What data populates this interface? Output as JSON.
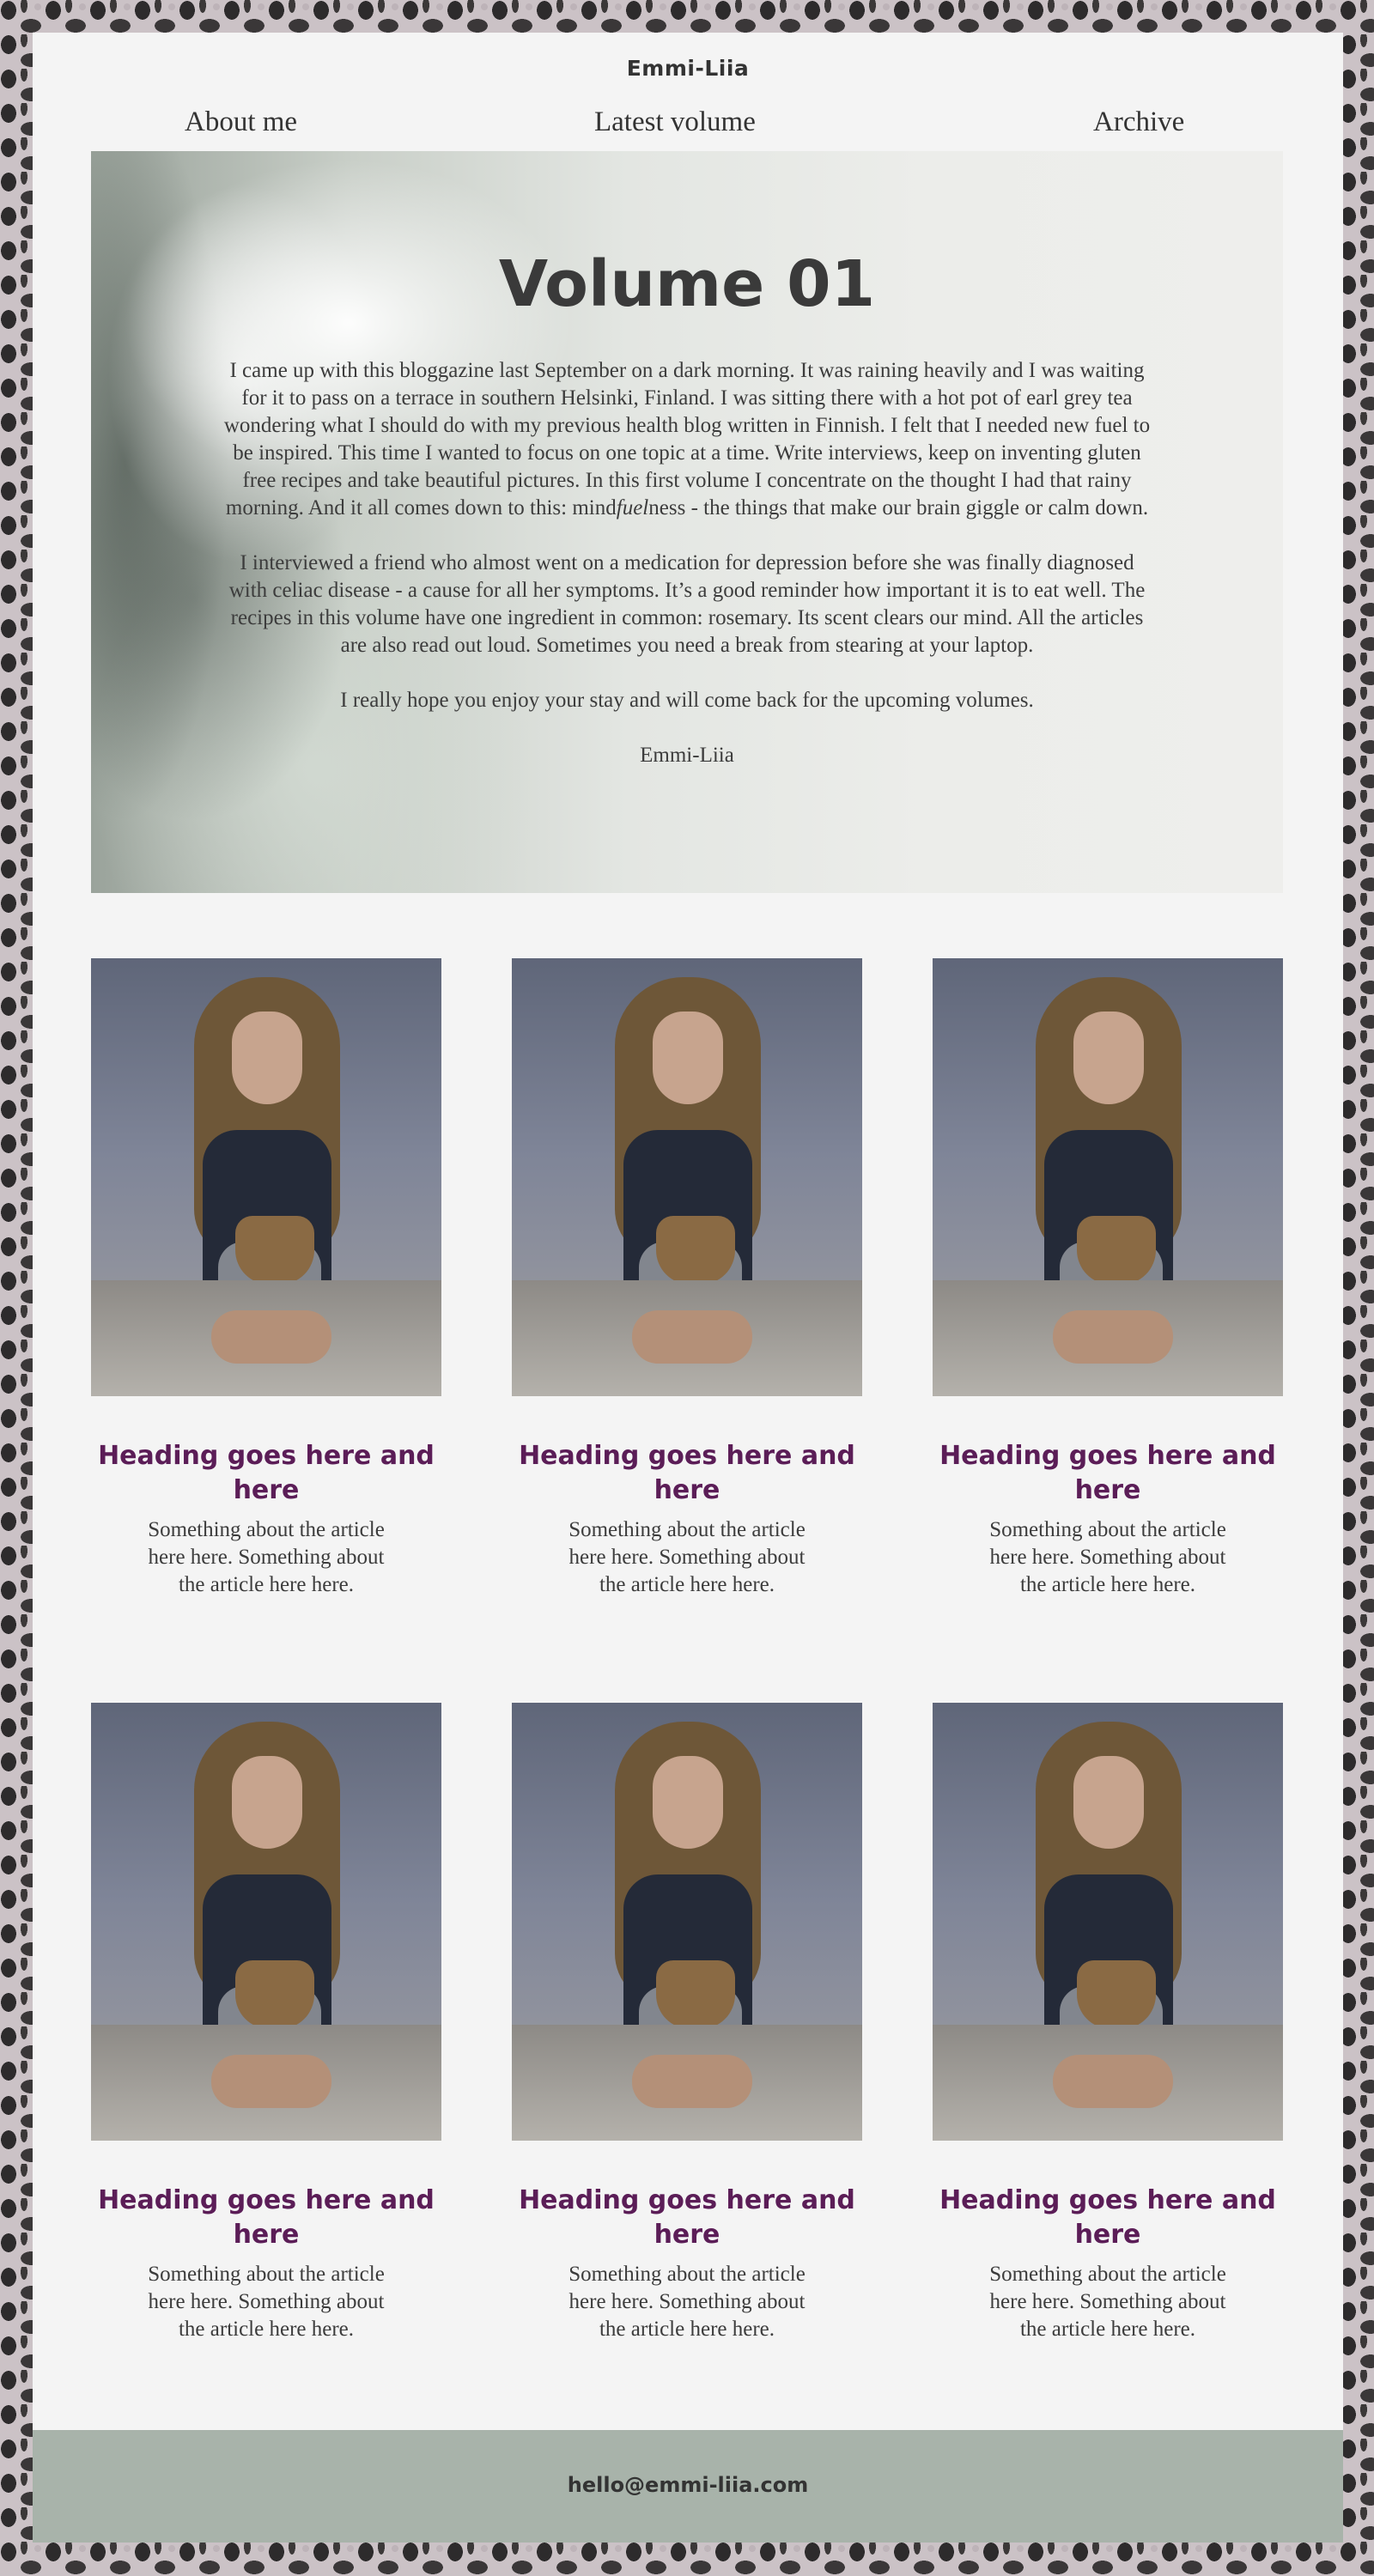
{
  "site": {
    "title": "Emmi-Liia"
  },
  "nav": {
    "about": "About me",
    "latest": "Latest volume",
    "archive": "Archive"
  },
  "hero": {
    "title": "Volume 01",
    "p1_before": "I came up with this bloggazine last September on a dark morning. It was raining heavily and I was waiting for it to pass on a terrace in southern Helsinki, Finland. I was sitting there with a hot pot of earl grey tea wondering what I should do with my previous health blog written in Finnish. I felt that I needed new fuel to be inspired. This time I wanted to focus on one topic at a time. Write interviews, keep on inventing gluten free recipes and take beautiful pictures. In this first volume I concentrate on the thought I had that rainy morning. And it all comes down to this: mind",
    "p1_emph": "fuel",
    "p1_after": "ness - the things that make our brain giggle or calm down.",
    "p2": "I interviewed a friend who almost went on a medication for depression before she was finally diagnosed with celiac disease - a cause for all her symptoms. It’s a good reminder how important it is to eat well. The recipes in this volume have one ingredient in common: rosemary. Its scent clears our mind. All the articles are also read out loud. Sometimes you need a break from stearing at your laptop.",
    "p3": "I really hope you enjoy your stay and will come back for the upcoming volumes.",
    "signature": "Emmi-Liia"
  },
  "articles": [
    {
      "heading": "Heading goes here and here",
      "text": "Something about the article here here. Something about the article here here."
    },
    {
      "heading": "Heading goes here and here",
      "text": "Something about the article here here. Something about the article here here."
    },
    {
      "heading": "Heading goes here and here",
      "text": "Something about the article here here. Something about the article here here."
    },
    {
      "heading": "Heading goes here and here",
      "text": "Something about the article here here. Something about the article here here."
    },
    {
      "heading": "Heading goes here and here",
      "text": "Something about the article here here. Something about the article here here."
    },
    {
      "heading": "Heading goes here and here",
      "text": "Something about the article here here. Something about the article here here."
    }
  ],
  "footer": {
    "email": "hello@emmi-liia.com"
  },
  "colors": {
    "background_pattern": "#cbc2c6",
    "page": "#f4f4f4",
    "heading_accent": "#5b1d57",
    "footer": "#a8b3aa"
  }
}
